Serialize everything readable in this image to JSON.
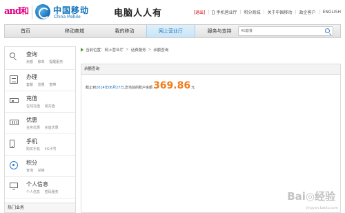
{
  "header": {
    "brand_and": "and",
    "brand_he": "和",
    "brand_cn": "中国移动",
    "brand_en": "China Mobile",
    "watermark_title": "电脑人人有",
    "toplinks": {
      "exit": "[退出]",
      "mobile_hall": "手机营业厅",
      "points_mall": "积分商城",
      "about": "关于中国移动",
      "enterprise": "政企客户",
      "english": "ENGLISH"
    }
  },
  "nav": {
    "items": [
      "首页",
      "移动商城",
      "我的移动",
      "网上营业厅",
      "服务与支持"
    ],
    "active_index": 3,
    "search_placeholder": "4G套餐"
  },
  "sidebar": {
    "items": [
      {
        "title": "查询",
        "subs": [
          "余额",
          "账单",
          "提醒服务"
        ],
        "icon": "search-icon"
      },
      {
        "title": "办理",
        "subs": [
          "套餐",
          "流量",
          "宽带"
        ],
        "icon": "document-icon"
      },
      {
        "title": "充值",
        "subs": [
          "在线充值",
          "易充值"
        ],
        "icon": "card-icon"
      },
      {
        "title": "优惠",
        "subs": [
          "业务优惠",
          "充值优惠"
        ],
        "icon": "discount-icon"
      },
      {
        "title": "手机",
        "subs": [
          "购买手机",
          "4G卡号"
        ],
        "icon": "phone-icon"
      },
      {
        "title": "积分",
        "subs": [
          "查询",
          "兑换"
        ],
        "icon": "points-icon"
      },
      {
        "title": "个人信息",
        "subs": [
          "个人信息",
          "密码服务"
        ],
        "icon": "monitor-icon"
      }
    ],
    "bottom_label": "热门业务"
  },
  "breadcrumb": {
    "prefix": "当前位置：",
    "items": [
      "网上营业厅",
      "话费服务",
      "余额查询"
    ]
  },
  "panel": {
    "title": "余额查询",
    "text_before": "截止到",
    "date": "2014年06月27日",
    "text_middle": ",您当前的账户余额",
    "amount": "369.86",
    "unit": "元"
  },
  "watermark": {
    "main": "Bai◎经验",
    "sub": "jingyan.baidu.com"
  },
  "colors": {
    "brand_blue": "#0d6eb8",
    "brand_pink": "#e4007f",
    "amount_orange": "#f07c1b",
    "date_blue": "#1c6fbd"
  }
}
